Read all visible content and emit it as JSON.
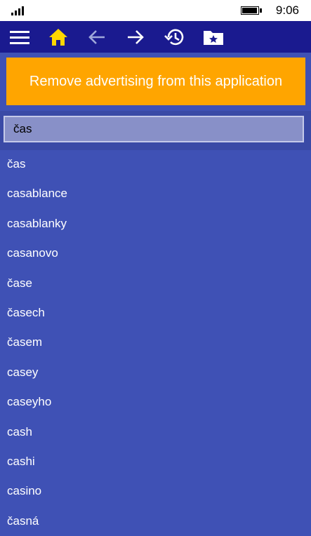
{
  "status_bar": {
    "time": "9:06",
    "signal_icon": "signal-strength-icon",
    "battery_icon": "battery-icon"
  },
  "toolbar": {
    "buttons": [
      {
        "name": "menu",
        "icon": "hamburger-menu-icon"
      },
      {
        "name": "home",
        "icon": "home-icon",
        "color": "#ffd700"
      },
      {
        "name": "back",
        "icon": "arrow-left-icon",
        "color": "#9fa8da"
      },
      {
        "name": "forward",
        "icon": "arrow-right-icon"
      },
      {
        "name": "history",
        "icon": "history-icon"
      },
      {
        "name": "favorites",
        "icon": "star-folder-icon"
      }
    ]
  },
  "ad_banner": {
    "label": "Remove advertising from this application",
    "color": "#ffa500"
  },
  "search": {
    "value": "čas"
  },
  "results": [
    "čas",
    "casablance",
    "casablanky",
    "casanovo",
    "čase",
    "časech",
    "časem",
    "casey",
    "caseyho",
    "cash",
    "cashi",
    "casino",
    "časná"
  ],
  "colors": {
    "background": "#3f51b5",
    "toolbar": "#1a1a8f",
    "accent": "#ffd700"
  }
}
